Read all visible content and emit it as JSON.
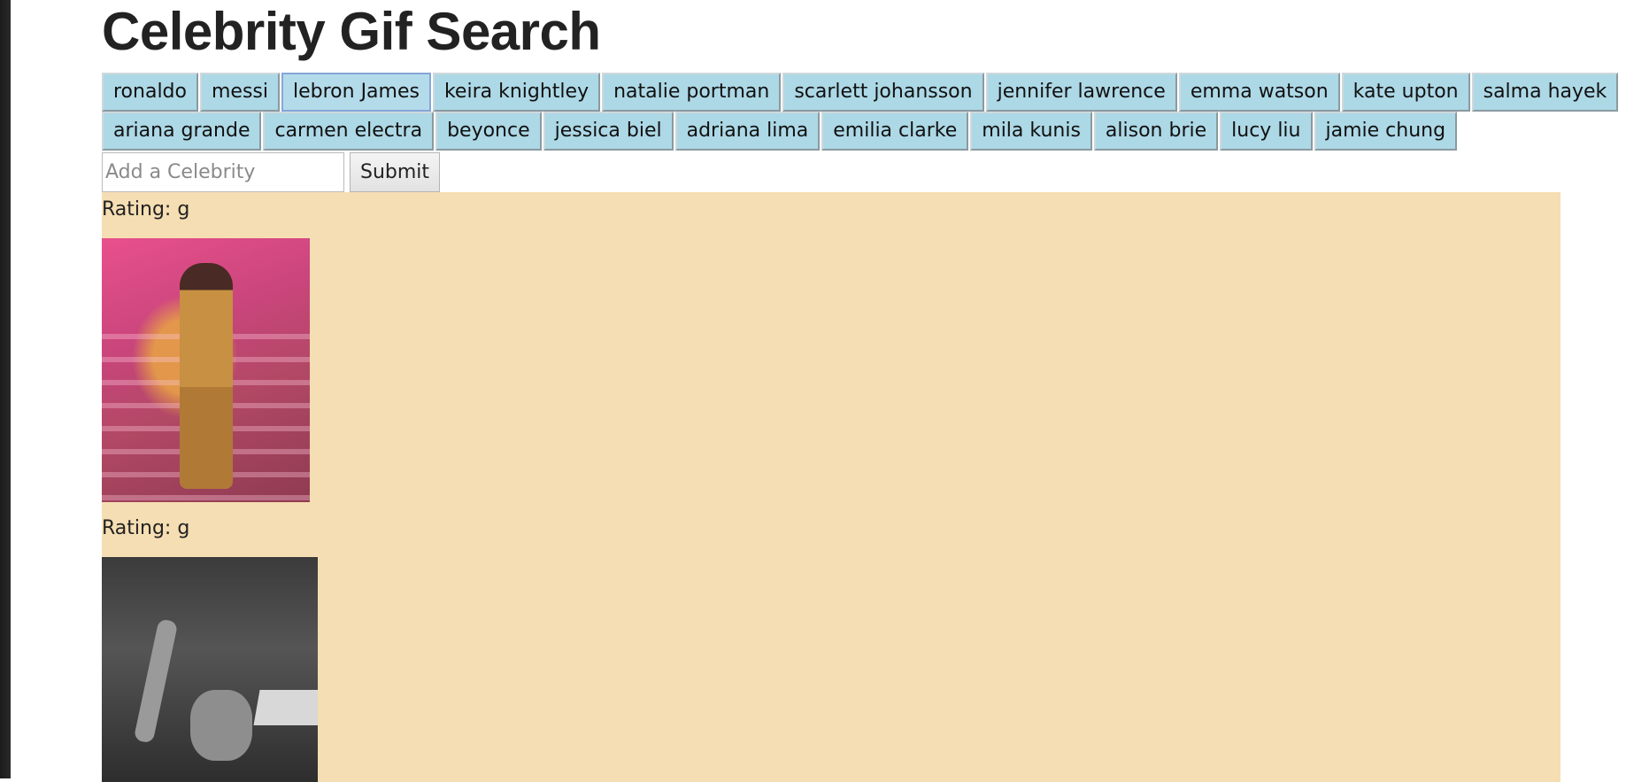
{
  "page": {
    "title": "Celebrity Gif Search"
  },
  "buttons_row1": [
    "ronaldo",
    "messi",
    "lebron James",
    "keira knightley",
    "natalie portman",
    "scarlett johansson",
    "jennifer lawrence",
    "emma watson",
    "kate upton",
    "salma hayek"
  ],
  "buttons_row2": [
    "ariana grande",
    "carmen electra",
    "beyonce",
    "jessica biel",
    "adriana lima",
    "emilia clarke",
    "mila kunis",
    "alison brie",
    "lucy liu",
    "jamie chung"
  ],
  "form": {
    "placeholder": "Add a Celebrity",
    "value": "",
    "submit_label": "Submit"
  },
  "results": [
    {
      "rating_label": "Rating: g",
      "image_name": "gif-image"
    },
    {
      "rating_label": "Rating: g",
      "image_name": "gif-image"
    }
  ],
  "colors": {
    "button_bg": "#add8e6",
    "results_bg": "#f5deb3"
  }
}
